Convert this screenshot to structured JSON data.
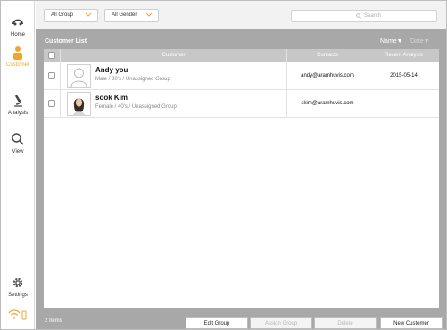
{
  "sidebar": {
    "items": [
      {
        "label": "Home",
        "icon": "logo-icon"
      },
      {
        "label": "Customer",
        "icon": "person-icon",
        "active": true
      },
      {
        "label": "Analysis",
        "icon": "microscope-icon"
      },
      {
        "label": "View",
        "icon": "magnifier-icon"
      },
      {
        "label": "Settings",
        "icon": "gear-icon"
      }
    ],
    "accent_color": "#f0a531"
  },
  "filters": {
    "group": "All Group",
    "gender": "All Gender"
  },
  "search": {
    "placeholder": "Search"
  },
  "list": {
    "title": "Customer List",
    "sort_name": "Name▼",
    "sort_date": "Date▼",
    "columns": {
      "customer": "Customer",
      "contacts": "Contacts",
      "recent": "Recent Analysis"
    },
    "rows": [
      {
        "name": "Andy you",
        "detail": "Male / 30's / Unassigned Group",
        "contact": "andy@aramhuvis.com",
        "recent": "2015-05-14"
      },
      {
        "name": "sook Kim",
        "detail": "Female / 40's / Unassigned Group",
        "contact": "skim@aramhuvis.com",
        "recent": "-"
      }
    ]
  },
  "footer": {
    "count": "2 Items",
    "edit_group": "Edit Group",
    "assign_group": "Assign Group",
    "delete": "Delete",
    "new_customer": "New Customer"
  }
}
